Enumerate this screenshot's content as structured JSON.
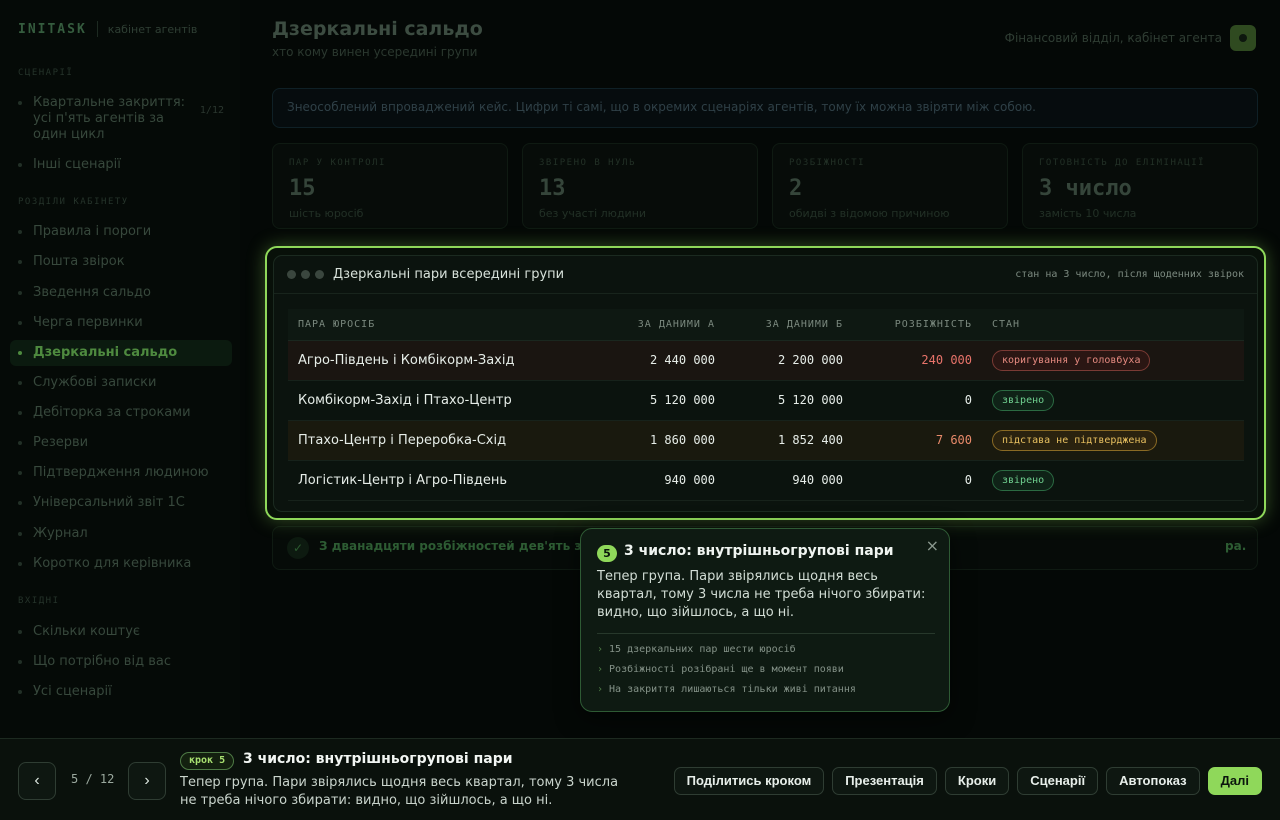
{
  "brand": {
    "logo": "INITASK",
    "subtitle": "кабінет агентів"
  },
  "sidebar": {
    "sections": [
      {
        "label": "СЦЕНАРІЇ"
      },
      {
        "label": "РОЗДІЛИ КАБІНЕТУ"
      },
      {
        "label": "ВХІДНІ"
      }
    ],
    "scenarios": [
      {
        "label": "Квартальне закриття: усі п'ять агентів за один цикл",
        "count": "1/12"
      },
      {
        "label": "Інші сценарії"
      }
    ],
    "sections_items": [
      {
        "label": "Правила і пороги"
      },
      {
        "label": "Пошта звірок"
      },
      {
        "label": "Зведення сальдо"
      },
      {
        "label": "Черга первинки"
      },
      {
        "label": "Дзеркальні сальдо"
      },
      {
        "label": "Службові записки"
      },
      {
        "label": "Дебіторка за строками"
      },
      {
        "label": "Резерви"
      },
      {
        "label": "Підтвердження людиною"
      },
      {
        "label": "Універсальний звіт 1С"
      },
      {
        "label": "Журнал"
      },
      {
        "label": "Коротко для керівника"
      }
    ],
    "inbox_items": [
      {
        "label": "Скільки коштує"
      },
      {
        "label": "Що потрібно від вас"
      },
      {
        "label": "Усі сценарії"
      }
    ]
  },
  "header": {
    "title": "Дзеркальні сальдо",
    "subtitle": "хто кому винен усередині групи",
    "right_text": "Фінансовий відділ, кабінет агента"
  },
  "notice": "Знеособлений впроваджений кейс. Цифри ті самі, що в окремих сценаріях агентів, тому їх можна звіряти між собою.",
  "stats": [
    {
      "label": "ПАР У КОНТРОЛІ",
      "value": "15",
      "desc": "шість юросіб"
    },
    {
      "label": "ЗВІРЕНО В НУЛЬ",
      "value": "13",
      "desc": "без участі людини"
    },
    {
      "label": "РОЗБІЖНОСТІ",
      "value": "2",
      "desc": "обидві з відомою причиною"
    },
    {
      "label": "ГОТОВНІСТЬ ДО ЕЛІМІНАЦІЇ",
      "value": "3 число",
      "desc": "замість 10 числа"
    }
  ],
  "bottom_note": {
    "text": "З дванадцяти розбіжностей дев'ять зак",
    "tail": "ра."
  },
  "table_card": {
    "title": "Дзеркальні пари всередині групи",
    "status": "стан на 3 число, після щоденних звірок",
    "columns": [
      "ПАРА ЮРОСІБ",
      "ЗА ДАНИМИ А",
      "ЗА ДАНИМИ Б",
      "РОЗБІЖНІСТЬ",
      "СТАН"
    ],
    "rows": [
      {
        "pair": "Агро-Південь і Комбікорм-Захід",
        "a": "2 440 000",
        "b": "2 200 000",
        "diff": "240 000",
        "state": "коригування у головбуха"
      },
      {
        "pair": "Комбікорм-Захід і Птахо-Центр",
        "a": "5 120 000",
        "b": "5 120 000",
        "diff": "0",
        "state": "звірено"
      },
      {
        "pair": "Птахо-Центр і Переробка-Схід",
        "a": "1 860 000",
        "b": "1 852 400",
        "diff": "7 600",
        "state": "підстава не підтверджена"
      },
      {
        "pair": "Логістик-Центр і Агро-Південь",
        "a": "940 000",
        "b": "940 000",
        "diff": "0",
        "state": "звірено"
      }
    ]
  },
  "popover": {
    "number": "5",
    "title": "3 число: внутрішньогрупові пари",
    "close": "×",
    "body": "Тепер група. Пари звірялись щодня весь квартал, тому 3 числа не треба нічого збирати: видно, що зійшлось, а що ні.",
    "bullets": [
      "15 дзеркальних пар шести юросіб",
      "Розбіжності розібрані ще в момент появи",
      "На закриття лишаються тільки живі питання"
    ]
  },
  "tourbar": {
    "prev": "‹",
    "next": "›",
    "counter": "5 / 12",
    "step_label": "крок 5",
    "title": "3 число: внутрішньогрупові пари",
    "desc": "Тепер група. Пари звірялись щодня весь квартал, тому 3 числа не треба нічого збирати: видно, що зійшлось, а що ні.",
    "actions": [
      "Поділитись кроком",
      "Презентація",
      "Кроки",
      "Сценарії",
      "Автопоказ"
    ],
    "primary": "Далі"
  },
  "colors": {
    "accent": "#8fd85a",
    "danger": "#e8736a",
    "warning": "#e8c060",
    "success": "#70d090"
  }
}
